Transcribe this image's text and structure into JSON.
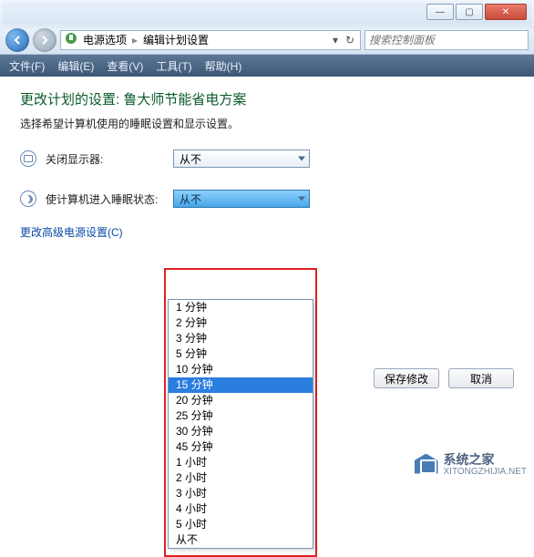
{
  "window": {
    "minimize": "—",
    "maximize": "▢",
    "close": "✕"
  },
  "nav": {
    "back": "←",
    "forward": "→",
    "breadcrumb1": "电源选项",
    "breadcrumb2": "编辑计划设置",
    "search_placeholder": "搜索控制面板"
  },
  "menu": {
    "file": "文件(F)",
    "edit": "编辑(E)",
    "view": "查看(V)",
    "tools": "工具(T)",
    "help": "帮助(H)"
  },
  "page": {
    "heading": "更改计划的设置: 鲁大师节能省电方案",
    "description": "选择希望计算机使用的睡眠设置和显示设置。",
    "turn_off_display_label": "关闭显示器:",
    "sleep_label": "使计算机进入睡眠状态:",
    "turn_off_display_value": "从不",
    "sleep_value": "从不",
    "advanced_link": "更改高级电源设置(C)",
    "save_btn": "保存修改",
    "cancel_btn": "取消"
  },
  "sleep_options": [
    "1 分钟",
    "2 分钟",
    "3 分钟",
    "5 分钟",
    "10 分钟",
    "15 分钟",
    "20 分钟",
    "25 分钟",
    "30 分钟",
    "45 分钟",
    "1 小时",
    "2 小时",
    "3 小时",
    "4 小时",
    "5 小时",
    "从不"
  ],
  "sleep_highlight_index": 5,
  "watermark": {
    "title": "系统之家",
    "sub": "XITONGZHIJIA.NET"
  }
}
